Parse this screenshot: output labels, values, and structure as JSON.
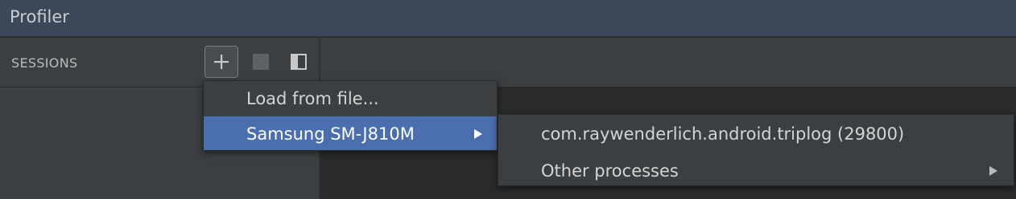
{
  "window": {
    "title": "Profiler"
  },
  "sessions": {
    "header_label": "SESSIONS",
    "add_button_icon": "plus-icon",
    "stop_button_icon": "stop-icon",
    "layout_button_icon": "panel-toggle-icon"
  },
  "context_menu": {
    "items": [
      {
        "label": "Load from file...",
        "selected": false,
        "has_submenu": false
      },
      {
        "label": "Samsung SM-J810M",
        "selected": true,
        "has_submenu": true
      }
    ]
  },
  "submenu": {
    "items": [
      {
        "label": "com.raywenderlich.android.triplog (29800)",
        "has_submenu": false
      },
      {
        "label": "Other processes",
        "has_submenu": true
      }
    ]
  },
  "colors": {
    "titlebar": "#3c4857",
    "panel": "#3c3f41",
    "selection": "#4b6eaf"
  }
}
